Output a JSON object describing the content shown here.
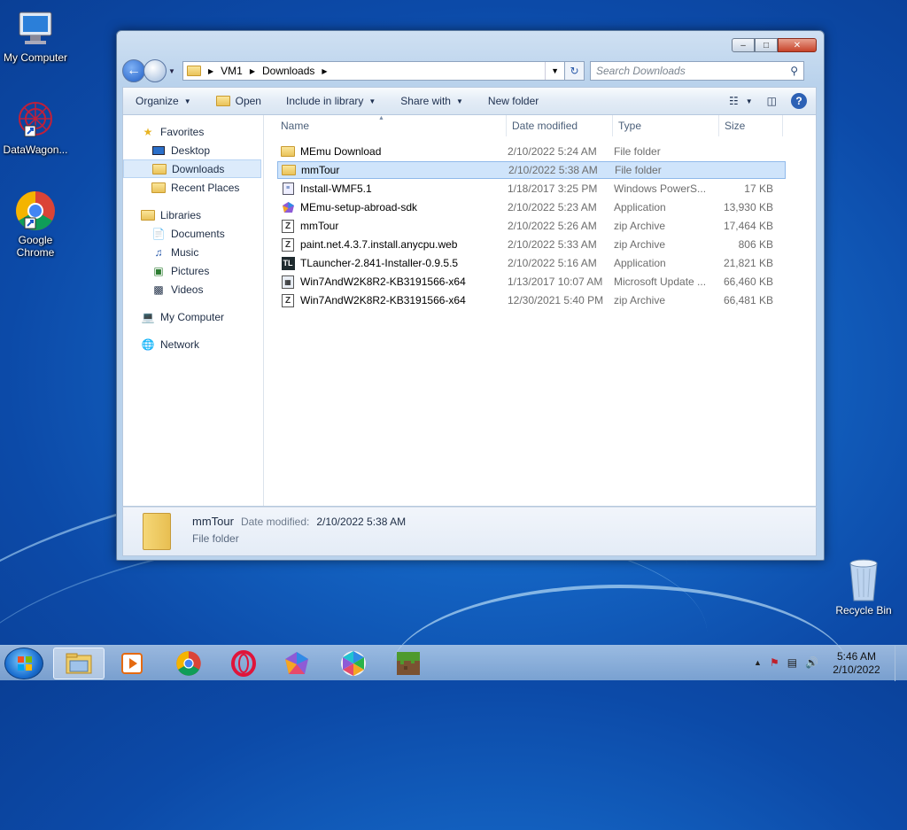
{
  "desktop": {
    "icons": [
      {
        "label": "My Computer"
      },
      {
        "label": "DataWagon..."
      },
      {
        "label": "Google Chrome"
      },
      {
        "label": "Recycle Bin"
      }
    ]
  },
  "window": {
    "caption_buttons": {
      "minimize": "–",
      "maximize": "□",
      "close": "✕"
    },
    "address": {
      "crumbs": [
        "VM1",
        "Downloads"
      ]
    },
    "search": {
      "placeholder": "Search Downloads"
    },
    "toolbar": {
      "organize": "Organize",
      "open": "Open",
      "include": "Include in library",
      "share": "Share with",
      "new_folder": "New folder"
    },
    "nav": {
      "favorites": "Favorites",
      "desktop": "Desktop",
      "downloads": "Downloads",
      "recent": "Recent Places",
      "libraries": "Libraries",
      "documents": "Documents",
      "music": "Music",
      "pictures": "Pictures",
      "videos": "Videos",
      "computer": "My Computer",
      "network": "Network"
    },
    "columns": {
      "name": "Name",
      "date": "Date modified",
      "type": "Type",
      "size": "Size"
    },
    "files": [
      {
        "name": "MEmu Download",
        "date": "2/10/2022 5:24 AM",
        "type": "File folder",
        "size": "",
        "icon": "folder"
      },
      {
        "name": "mmTour",
        "date": "2/10/2022 5:38 AM",
        "type": "File folder",
        "size": "",
        "icon": "folder"
      },
      {
        "name": "Install-WMF5.1",
        "date": "1/18/2017 3:25 PM",
        "type": "Windows PowerS...",
        "size": "17 KB",
        "icon": "script"
      },
      {
        "name": "MEmu-setup-abroad-sdk",
        "date": "2/10/2022 5:23 AM",
        "type": "Application",
        "size": "13,930 KB",
        "icon": "memu"
      },
      {
        "name": "mmTour",
        "date": "2/10/2022 5:26 AM",
        "type": "zip Archive",
        "size": "17,464 KB",
        "icon": "zip"
      },
      {
        "name": "paint.net.4.3.7.install.anycpu.web",
        "date": "2/10/2022 5:33 AM",
        "type": "zip Archive",
        "size": "806 KB",
        "icon": "zip"
      },
      {
        "name": "TLauncher-2.841-Installer-0.9.5.5",
        "date": "2/10/2022 5:16 AM",
        "type": "Application",
        "size": "21,821 KB",
        "icon": "tl"
      },
      {
        "name": "Win7AndW2K8R2-KB3191566-x64",
        "date": "1/13/2017 10:07 AM",
        "type": "Microsoft Update ...",
        "size": "66,460 KB",
        "icon": "msu"
      },
      {
        "name": "Win7AndW2K8R2-KB3191566-x64",
        "date": "12/30/2021 5:40 PM",
        "type": "zip Archive",
        "size": "66,481 KB",
        "icon": "zip"
      }
    ],
    "details": {
      "name": "mmTour",
      "date_label": "Date modified:",
      "date_value": "2/10/2022 5:38 AM",
      "type": "File folder"
    }
  },
  "taskbar": {
    "clock_time": "5:46 AM",
    "clock_date": "2/10/2022"
  }
}
